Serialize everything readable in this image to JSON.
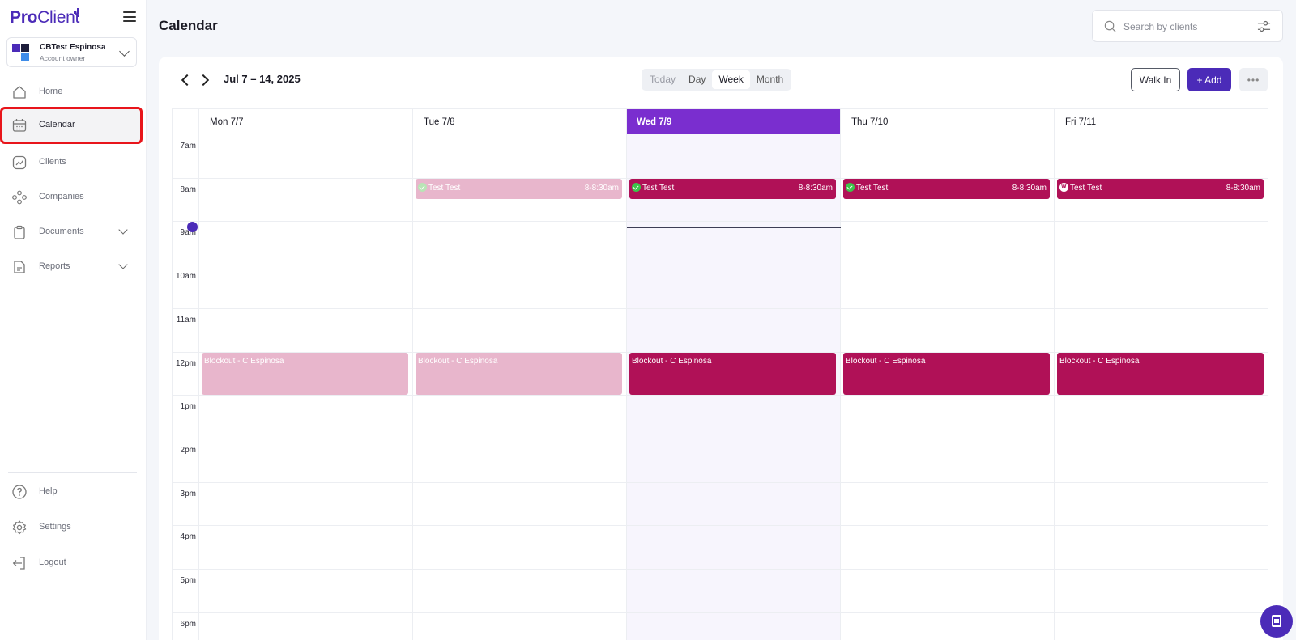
{
  "app": {
    "logo_pro": "Pro",
    "logo_client": "Client"
  },
  "account": {
    "name": "CBTest Espinosa",
    "role": "Account owner"
  },
  "nav": {
    "home": "Home",
    "calendar": "Calendar",
    "clients": "Clients",
    "companies": "Companies",
    "documents": "Documents",
    "reports": "Reports",
    "help": "Help",
    "settings": "Settings",
    "logout": "Logout"
  },
  "header": {
    "title": "Calendar",
    "search_placeholder": "Search by clients"
  },
  "toolbar": {
    "range": "Jul 7 – 14, 2025",
    "views": [
      "Today",
      "Day",
      "Week",
      "Month"
    ],
    "selected_view": "Week",
    "walk_in": "Walk In",
    "add": "+ Add",
    "more": "•••"
  },
  "calendar": {
    "days": [
      {
        "label": "Mon 7/7",
        "today": false
      },
      {
        "label": "Tue 7/8",
        "today": false
      },
      {
        "label": "Wed 7/9",
        "today": true
      },
      {
        "label": "Thu 7/10",
        "today": false
      },
      {
        "label": "Fri 7/11",
        "today": false
      }
    ],
    "hours": [
      "7am",
      "8am",
      "9am",
      "10am",
      "11am",
      "12pm",
      "1pm",
      "2pm",
      "3pm",
      "4pm",
      "5pm",
      "6pm"
    ],
    "current_time_hour": 9.15,
    "events": [
      {
        "day": 1,
        "title": "Test Test",
        "time": "8-8:30am",
        "start": 8,
        "end": 8.5,
        "past": true,
        "badge": "check"
      },
      {
        "day": 2,
        "title": "Test Test",
        "time": "8-8:30am",
        "start": 8,
        "end": 8.5,
        "past": false,
        "badge": "check"
      },
      {
        "day": 3,
        "title": "Test Test",
        "time": "8-8:30am",
        "start": 8,
        "end": 8.5,
        "past": false,
        "badge": "check"
      },
      {
        "day": 4,
        "title": "Test Test",
        "time": "8-8:30am",
        "start": 8,
        "end": 8.5,
        "past": false,
        "badge": "w",
        "badge_text": "W"
      },
      {
        "day": 0,
        "title": "Blockout - C Espinosa",
        "time": "",
        "start": 12,
        "end": 13,
        "past": true,
        "badge": "none"
      },
      {
        "day": 1,
        "title": "Blockout - C Espinosa",
        "time": "",
        "start": 12,
        "end": 13,
        "past": true,
        "badge": "none"
      },
      {
        "day": 2,
        "title": "Blockout - C Espinosa",
        "time": "",
        "start": 12,
        "end": 13,
        "past": false,
        "badge": "none"
      },
      {
        "day": 3,
        "title": "Blockout - C Espinosa",
        "time": "",
        "start": 12,
        "end": 13,
        "past": false,
        "badge": "none"
      },
      {
        "day": 4,
        "title": "Blockout - C Espinosa",
        "time": "",
        "start": 12,
        "end": 13,
        "past": false,
        "badge": "none"
      }
    ]
  },
  "colors": {
    "brand": "#4b2bb8",
    "today_header": "#7a2ecf",
    "event": "#b01157",
    "event_past": "#e8b6cc",
    "highlight_border": "#e8151b"
  }
}
